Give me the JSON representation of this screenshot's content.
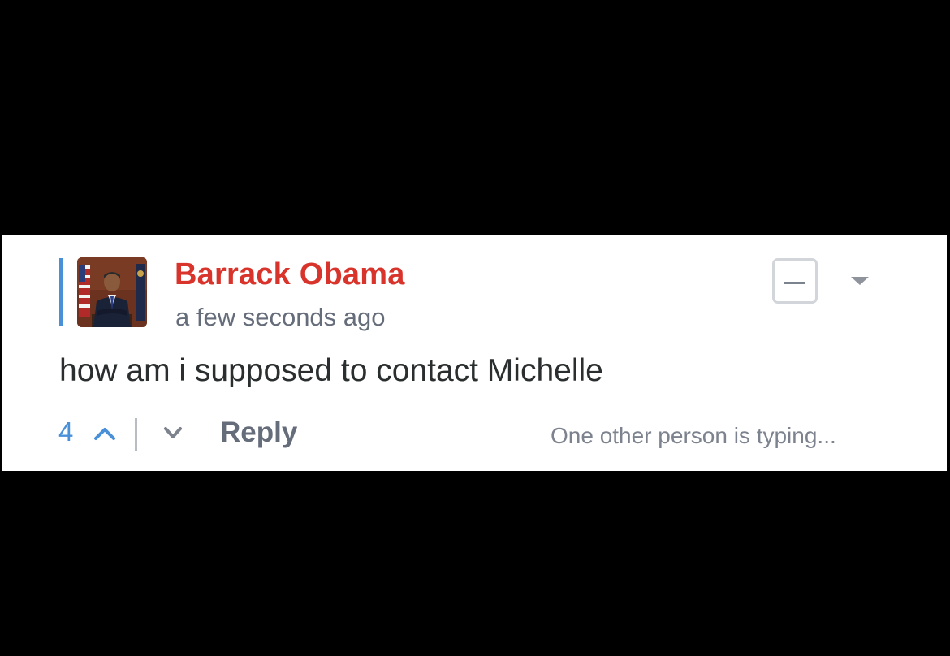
{
  "comment": {
    "author": "Barrack Obama",
    "timestamp": "a few seconds ago",
    "message": "how am i supposed to contact Michelle",
    "votes": "4",
    "reply_label": "Reply",
    "typing_status": "One other person is typing..."
  },
  "colors": {
    "author": "#d9342b",
    "accent": "#4a90d9",
    "muted": "#656c7a",
    "background": "#000000",
    "card": "#ffffff"
  },
  "icons": {
    "collapse": "minus-box-icon",
    "menu": "caret-down-icon",
    "upvote": "chevron-up-icon",
    "downvote": "chevron-down-icon"
  }
}
